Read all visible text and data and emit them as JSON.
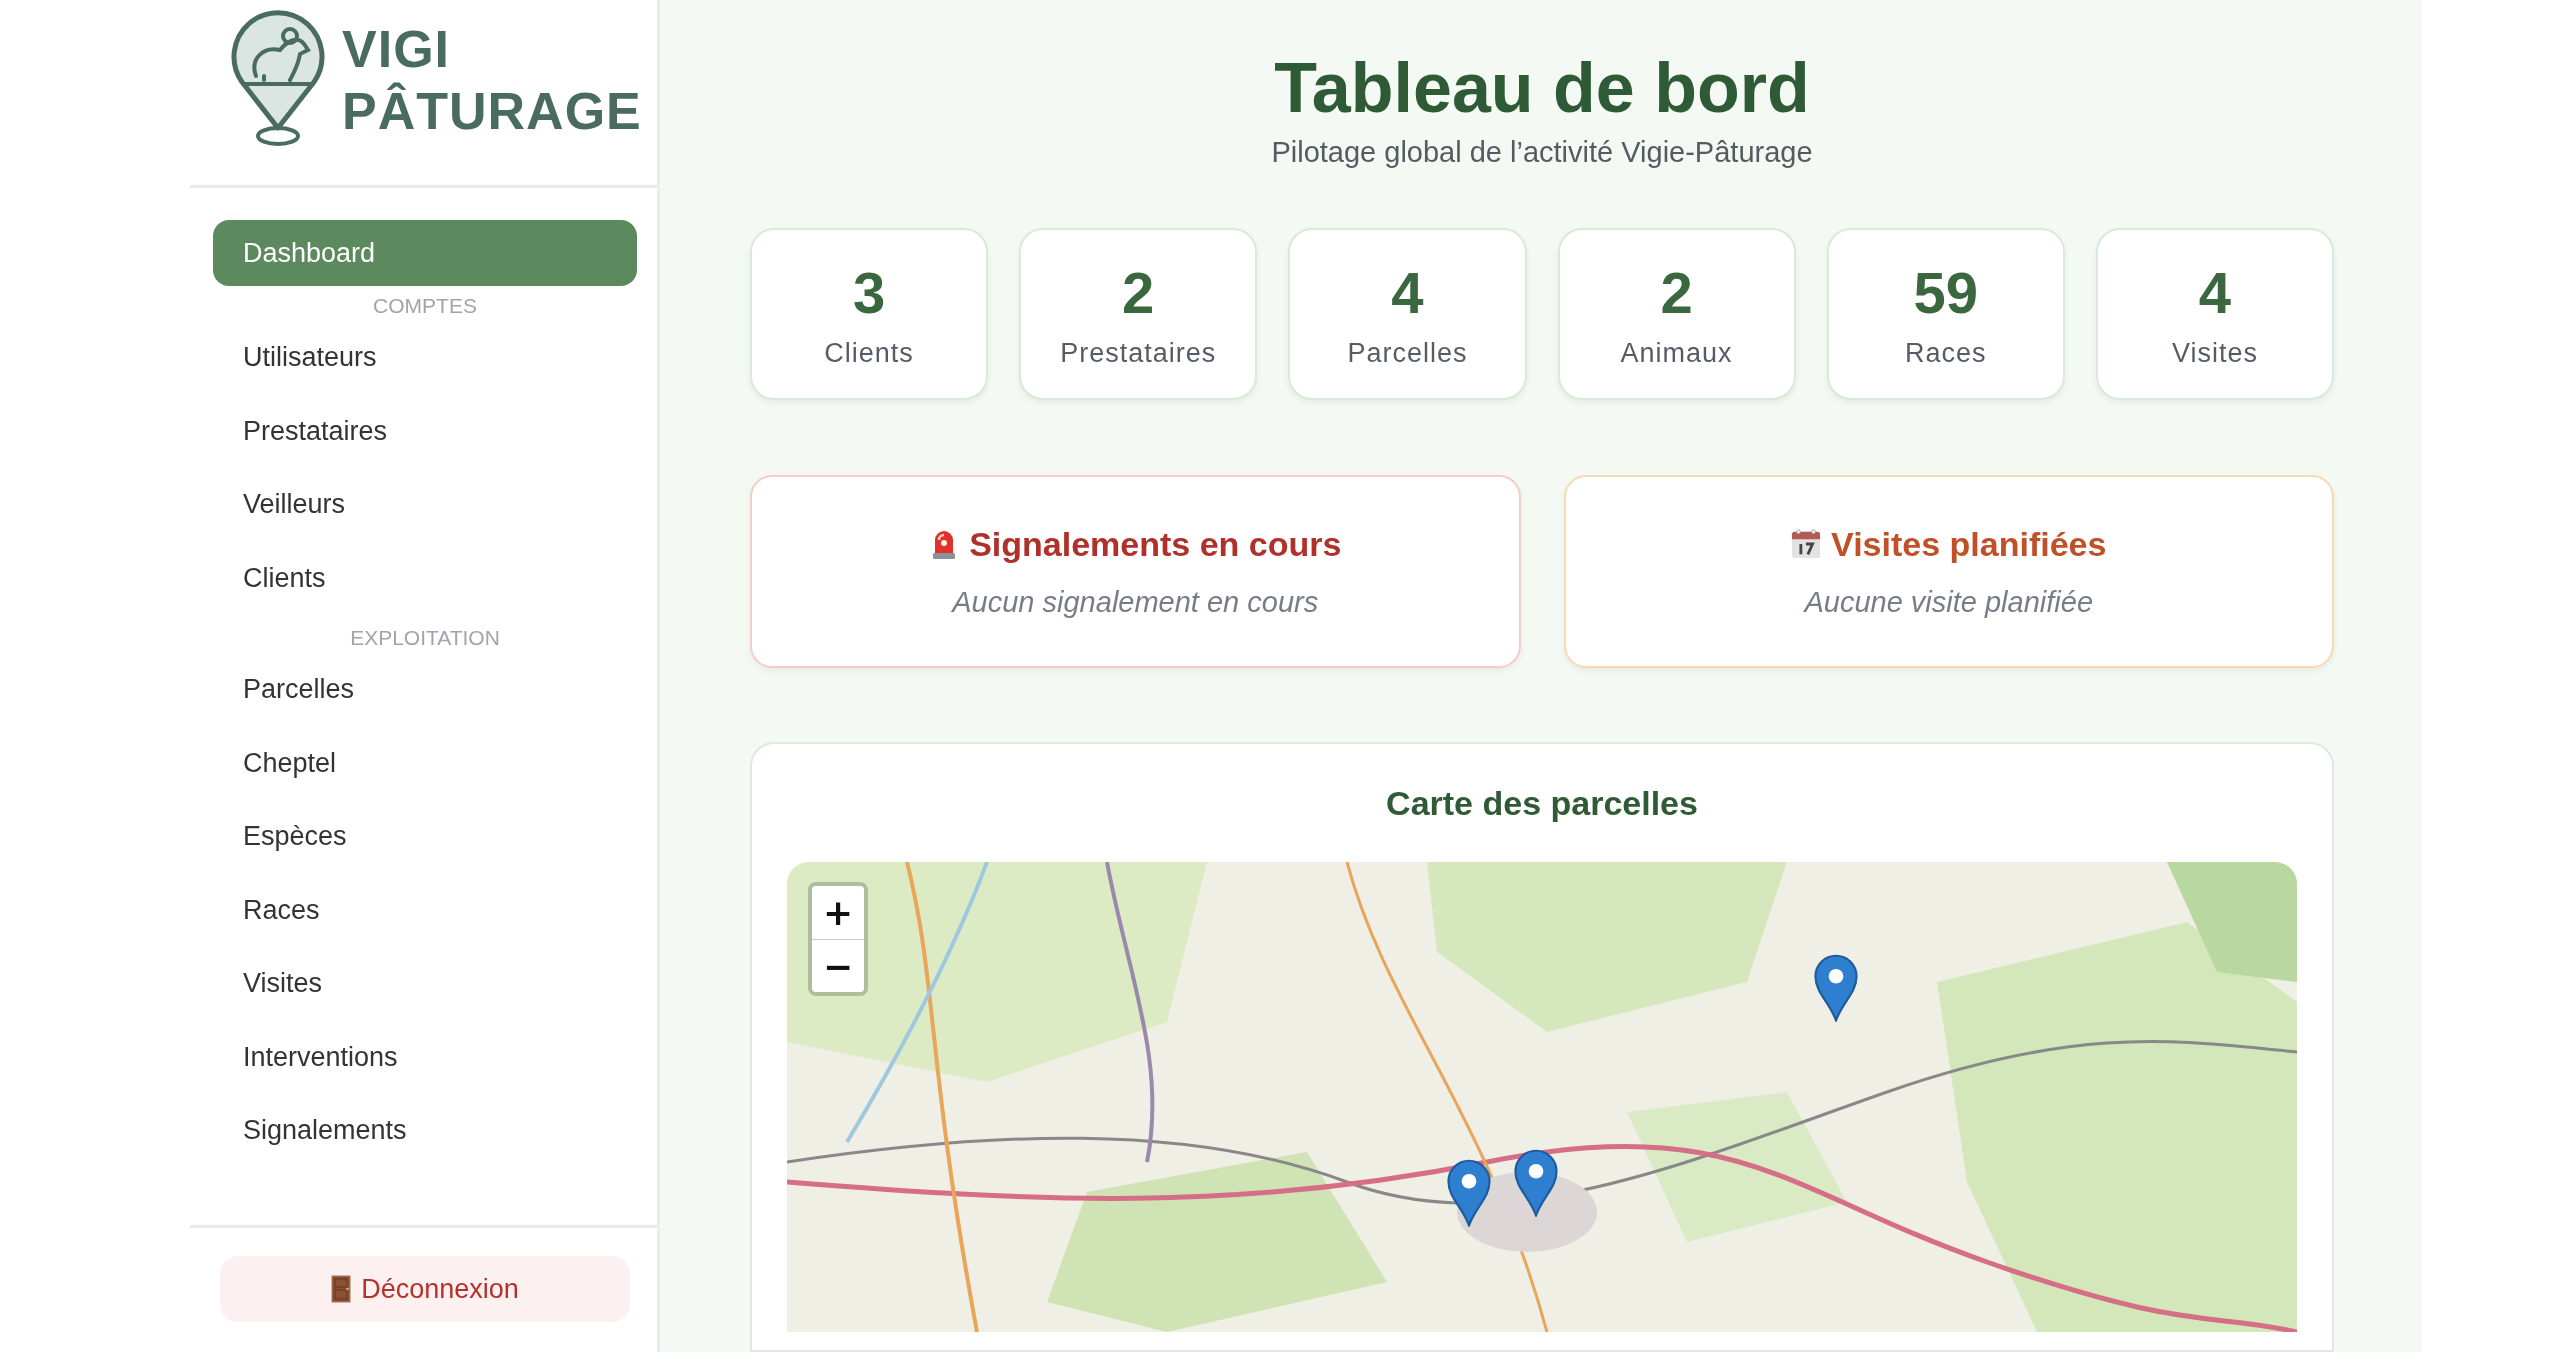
{
  "brand": {
    "line_1": "VIGI",
    "line_2": "PÂTURAGE"
  },
  "sidebar": {
    "items": [
      {
        "kind": "link",
        "label": "Dashboard",
        "selected": true
      },
      {
        "kind": "section",
        "label": "COMPTES"
      },
      {
        "kind": "link",
        "label": "Utilisateurs",
        "selected": false
      },
      {
        "kind": "link",
        "label": "Prestataires",
        "selected": false
      },
      {
        "kind": "link",
        "label": "Veilleurs",
        "selected": false
      },
      {
        "kind": "link",
        "label": "Clients",
        "selected": false
      },
      {
        "kind": "section",
        "label": "EXPLOITATION"
      },
      {
        "kind": "link",
        "label": "Parcelles",
        "selected": false
      },
      {
        "kind": "link",
        "label": "Cheptel",
        "selected": false
      },
      {
        "kind": "link",
        "label": "Espèces",
        "selected": false
      },
      {
        "kind": "link",
        "label": "Races",
        "selected": false
      },
      {
        "kind": "link",
        "label": "Visites",
        "selected": false
      },
      {
        "kind": "link",
        "label": "Interventions",
        "selected": false
      },
      {
        "kind": "link",
        "label": "Signalements",
        "selected": false
      }
    ],
    "logout": {
      "label": "Déconnexion"
    }
  },
  "header": {
    "title": "Tableau de bord",
    "subtitle": "Pilotage global de l’activité Vigie-Pâturage"
  },
  "stats": [
    {
      "value": "3",
      "label": "Clients"
    },
    {
      "value": "2",
      "label": "Prestataires"
    },
    {
      "value": "4",
      "label": "Parcelles"
    },
    {
      "value": "2",
      "label": "Animaux"
    },
    {
      "value": "59",
      "label": "Races"
    },
    {
      "value": "4",
      "label": "Visites"
    }
  ],
  "panels": [
    {
      "kind": "alerts",
      "title": "Signalements en cours",
      "empty_text": "Aucun signalement en cours"
    },
    {
      "kind": "visits",
      "title": "Visites planifiées",
      "empty_text": "Aucune visite planifiée"
    }
  ],
  "map": {
    "title": "Carte des parcelles",
    "zoom_in": "+",
    "zoom_out": "−"
  }
}
